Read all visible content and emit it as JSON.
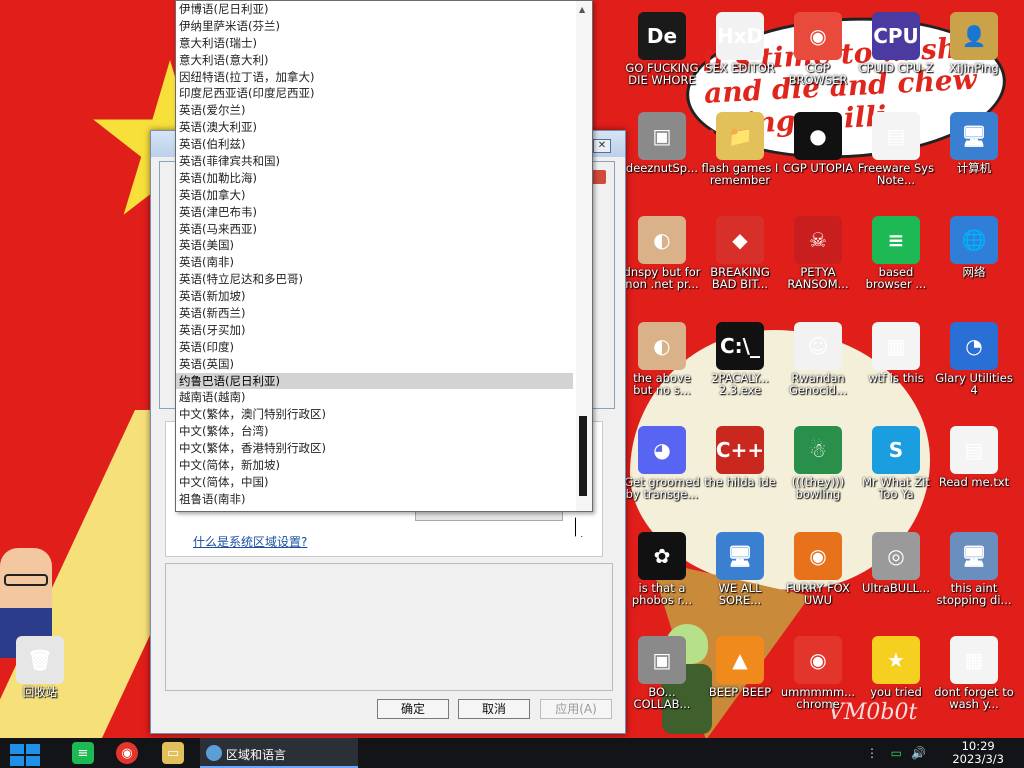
{
  "wallpaper": {
    "speech_text": "it's time to ... shi and die and chew ... ing ... illi",
    "watermark": "VM0b0t"
  },
  "dropdown": {
    "items": [
      "伊博语(尼日利亚)",
      "伊纳里萨米语(芬兰)",
      "意大利语(瑞士)",
      "意大利语(意大利)",
      "因纽特语(拉丁语，加拿大)",
      "印度尼西亚语(印度尼西亚)",
      "英语(爱尔兰)",
      "英语(澳大利亚)",
      "英语(伯利兹)",
      "英语(菲律宾共和国)",
      "英语(加勒比海)",
      "英语(加拿大)",
      "英语(津巴布韦)",
      "英语(马来西亚)",
      "英语(美国)",
      "英语(南非)",
      "英语(特立尼达和多巴哥)",
      "英语(新加坡)",
      "英语(新西兰)",
      "英语(牙买加)",
      "英语(印度)",
      "英语(英国)",
      "约鲁巴语(尼日利亚)",
      "越南语(越南)",
      "中文(繁体，澳门特别行政区)",
      "中文(繁体，台湾)",
      "中文(繁体，香港特别行政区)",
      "中文(简体，新加坡)",
      "中文(简体，中国)",
      "祖鲁语(南非)"
    ],
    "selected": "约鲁巴语(尼日利亚)"
  },
  "dialog": {
    "link_text": "什么是系统区域设置?",
    "ok_label": "确定",
    "cancel_label": "取消",
    "apply_label": "应用(A)"
  },
  "desktop_icons": [
    {
      "name": "go-fucking-die-whore",
      "label": "GO FUCKING DIE WHORE",
      "glyph": "De",
      "color": "#1a1a1a"
    },
    {
      "name": "sex-editor",
      "label": "SEX EDITOR",
      "glyph": "HxD",
      "color": "#f2f2f2"
    },
    {
      "name": "cgp-browser",
      "label": "CGP BROWSER",
      "glyph": "◉",
      "color": "#e84b3c"
    },
    {
      "name": "cpuid-cpu-z",
      "label": "CPUID CPU-Z",
      "glyph": "CPU",
      "color": "#4b3aa0"
    },
    {
      "name": "xunping",
      "label": "XiJinPing",
      "glyph": "👤",
      "color": "#c9a24a"
    },
    {
      "name": "deeznutsp",
      "label": "deeznutSp...",
      "glyph": "▣",
      "color": "#8a8a8a"
    },
    {
      "name": "flash-games",
      "label": "flash games I remember",
      "glyph": "📁",
      "color": "#e2c15a"
    },
    {
      "name": "cgp-utopia",
      "label": "CGP UTOPIA",
      "glyph": "●",
      "color": "#111"
    },
    {
      "name": "freeware-sys-note",
      "label": "Freeware Sys Note...",
      "glyph": "▤",
      "color": "#f4f4f4"
    },
    {
      "name": "computer",
      "label": "计算机",
      "glyph": "🖥",
      "color": "#3b7fd1"
    },
    {
      "name": "dnspy",
      "label": "dnspy but for non .net pr...",
      "glyph": "◐",
      "color": "#d9b28a"
    },
    {
      "name": "breaking-bad-bit",
      "label": "BREAKING BAD BIT...",
      "glyph": "◆",
      "color": "#d7302a"
    },
    {
      "name": "petya-ransom",
      "label": "PETYA RANSOM...",
      "glyph": "☠",
      "color": "#c81e1e"
    },
    {
      "name": "based-browser",
      "label": "based browser ...",
      "glyph": "≡",
      "color": "#1db954"
    },
    {
      "name": "network",
      "label": "网络",
      "glyph": "🌐",
      "color": "#2f7ed8"
    },
    {
      "name": "the-above",
      "label": "the above but no s...",
      "glyph": "◐",
      "color": "#d9b28a"
    },
    {
      "name": "2pacalypse",
      "label": "2PACALY... 2.3.exe",
      "glyph": "C:\\_",
      "color": "#111"
    },
    {
      "name": "rwandan-genocide",
      "label": "Rwandan Genocid...",
      "glyph": "☺",
      "color": "#f2f2f2"
    },
    {
      "name": "wtf-is-this",
      "label": "wtf is this",
      "glyph": "▦",
      "color": "#f4f4f4"
    },
    {
      "name": "glary-utilities",
      "label": "Glary Utilities 4",
      "glyph": "◔",
      "color": "#2a6fd6"
    },
    {
      "name": "discord",
      "label": "Get groomed by transge...",
      "glyph": "◕",
      "color": "#5865f2"
    },
    {
      "name": "the-hilda-ide",
      "label": "the hilda ide",
      "glyph": "C++",
      "color": "#c8281e"
    },
    {
      "name": "they-bowling",
      "label": "(((they))) bowling",
      "glyph": "☃",
      "color": "#2a8f4a"
    },
    {
      "name": "mr-what-zit",
      "label": "Mr What Zit Too Ya",
      "glyph": "S",
      "color": "#1a9ee0"
    },
    {
      "name": "read-me-txt",
      "label": "Read me.txt",
      "glyph": "▤",
      "color": "#f4f4f4"
    },
    {
      "name": "is-that-a-phobos",
      "label": "is that a phobos r...",
      "glyph": "✿",
      "color": "#111"
    },
    {
      "name": "we-all-sore",
      "label": "WE ALL SORE...",
      "glyph": "🖥",
      "color": "#3b7fd1"
    },
    {
      "name": "furry-fox-uwu",
      "label": "FURRY FOX UWU",
      "glyph": "◉",
      "color": "#e8721c"
    },
    {
      "name": "ultrabull",
      "label": "UltraBULL...",
      "glyph": "◎",
      "color": "#9a9a9a"
    },
    {
      "name": "this-aint-stopping",
      "label": "this aint stopping di...",
      "glyph": "🖥",
      "color": "#6a8fbf"
    },
    {
      "name": "recycle-bin",
      "label": "回收站",
      "glyph": "🗑",
      "color": "#e6e6e6"
    },
    {
      "name": "bo-collab",
      "label": "BO... COLLAB...",
      "glyph": "▣",
      "color": "#8a8a8a"
    },
    {
      "name": "beep-beep",
      "label": "BEEP BEEP",
      "glyph": "▲",
      "color": "#f08a1c"
    },
    {
      "name": "ummmmm-chrome",
      "label": "ummmmm... chrome",
      "glyph": "◉",
      "color": "#e2362c"
    },
    {
      "name": "you-tried",
      "label": "you tried",
      "glyph": "★",
      "color": "#f5d020"
    },
    {
      "name": "dont-forget",
      "label": "dont forget to wash y...",
      "glyph": "▦",
      "color": "#f4f4f4"
    }
  ],
  "taskbar": {
    "task_label": "区域和语言",
    "time": "10:29",
    "date": "2023/3/3"
  }
}
